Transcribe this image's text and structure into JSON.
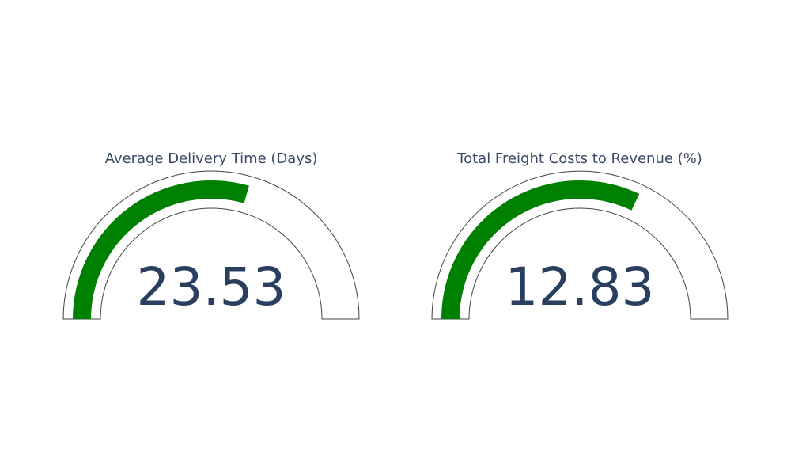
{
  "chart_data": [
    {
      "type": "gauge",
      "title": "Average Delivery Time (Days)",
      "value": 23.53,
      "value_label": "23.53",
      "range": [
        0,
        40
      ],
      "bar_color": "#008000"
    },
    {
      "type": "gauge",
      "title": "Total Freight Costs to Revenue (%)",
      "value": 12.83,
      "value_label": "12.83",
      "range": [
        0,
        20
      ],
      "bar_color": "#008000"
    }
  ]
}
